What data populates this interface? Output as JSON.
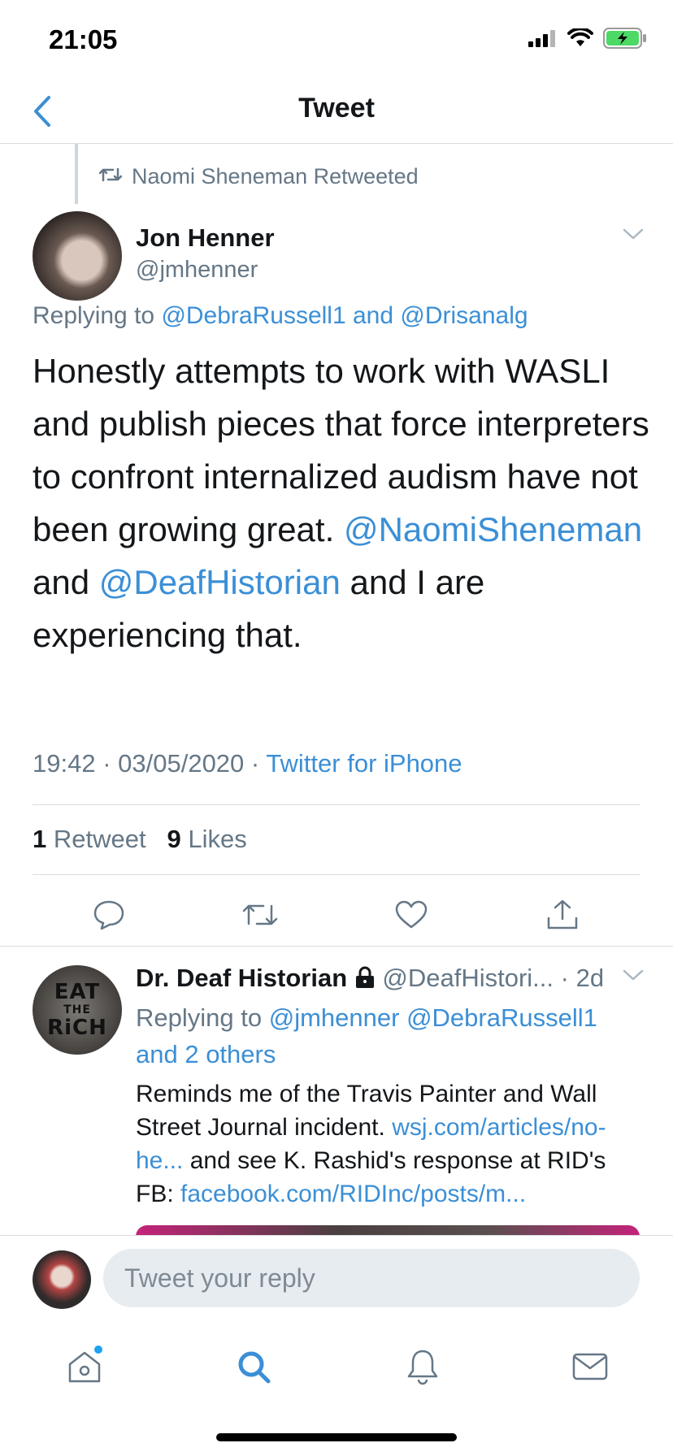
{
  "status_bar": {
    "time": "21:05"
  },
  "nav": {
    "title": "Tweet"
  },
  "retweet": {
    "label": "Naomi Sheneman Retweeted"
  },
  "tweet": {
    "author_name": "Jon Henner",
    "author_handle": "@jmhenner",
    "replying_prefix": "Replying to",
    "replying_user1": "@DebraRussell1",
    "replying_and": "and",
    "replying_user2": "@Drisanalg",
    "body_part1": "Honestly attempts to work with WASLI and publish pieces that force interpreters to confront internalized audism have not been growing great.",
    "mention1": "@NaomiSheneman",
    "body_and": "and",
    "mention2": "@DeafHistorian",
    "body_part2": "and I are experiencing that.",
    "time": "19:42",
    "date": "03/05/2020",
    "source": "Twitter for iPhone",
    "retweet_count": "1",
    "retweet_label": "Retweet",
    "like_count": "9",
    "like_label": "Likes"
  },
  "reply": {
    "author_name": "Dr. Deaf Historian",
    "author_handle": "@DeafHistori...",
    "age": "· 2d",
    "avatar_text_line1": "EAT",
    "avatar_text_line2": "THE",
    "avatar_text_line3": "RiCH",
    "replying_prefix": "Replying to",
    "replying_user1": "@jmhenner",
    "replying_user2": "@DebraRussell1",
    "replying_others": "and 2 others",
    "text_part1": "Reminds me of the Travis Painter and Wall Street Journal incident.",
    "link1": "wsj.com/articles/no-he...",
    "text_part2": "and see K. Rashid's response at RID's FB:",
    "link2": "facebook.com/RIDInc/posts/m..."
  },
  "compose": {
    "placeholder": "Tweet your reply"
  },
  "tabs": [
    {
      "name": "home",
      "icon": "home-icon"
    },
    {
      "name": "search",
      "icon": "search-icon"
    },
    {
      "name": "notifications",
      "icon": "bell-icon"
    },
    {
      "name": "messages",
      "icon": "mail-icon"
    }
  ],
  "colors": {
    "link": "#3b8fd6",
    "secondary": "#657786",
    "accent": "#1da1f2"
  }
}
